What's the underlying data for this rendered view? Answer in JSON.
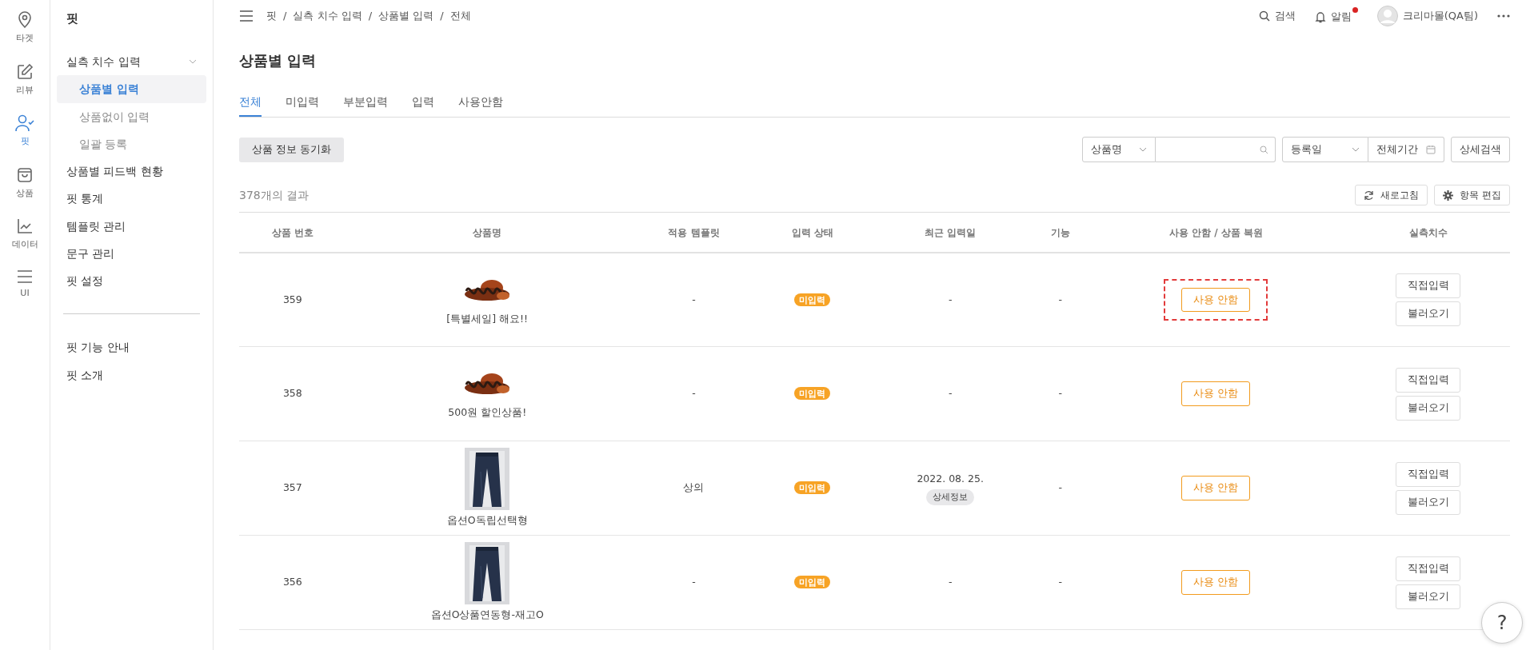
{
  "rail": [
    {
      "label": "타겟",
      "selected": false
    },
    {
      "label": "리뷰",
      "selected": false
    },
    {
      "label": "핏",
      "selected": true
    },
    {
      "label": "상품",
      "selected": false
    },
    {
      "label": "데이터",
      "selected": false
    },
    {
      "label": "UI",
      "selected": false
    }
  ],
  "sidebar": {
    "title": "핏",
    "items": [
      {
        "label": "실측 치수 입력",
        "expanded": true,
        "selected": false,
        "children": [
          {
            "label": "상품별 입력",
            "selected": true
          },
          {
            "label": "상품없이 입력",
            "selected": false
          },
          {
            "label": "일괄 등록",
            "selected": false
          }
        ]
      },
      {
        "label": "상품별 피드백 현황",
        "selected": false
      },
      {
        "label": "핏 통계",
        "selected": false
      },
      {
        "label": "템플릿 관리",
        "selected": false
      },
      {
        "label": "문구 관리",
        "selected": false
      },
      {
        "label": "핏 설정",
        "selected": false
      }
    ],
    "help_items": [
      {
        "label": "핏 기능 안내"
      },
      {
        "label": "핏 소개"
      }
    ]
  },
  "breadcrumb": {
    "separator": "/",
    "items": [
      "핏",
      "실측 치수 입력",
      "상품별 입력",
      "전체"
    ]
  },
  "header": {
    "search": "검색",
    "alerts": {
      "label": "알림",
      "unread": true
    },
    "user": "크리마몰(QA팀)"
  },
  "page_title": "상품별 입력",
  "tabs": [
    {
      "label": "전체",
      "selected": true
    },
    {
      "label": "미입력",
      "selected": false
    },
    {
      "label": "부분입력",
      "selected": false
    },
    {
      "label": "입력",
      "selected": false
    },
    {
      "label": "사용안함",
      "selected": false
    }
  ],
  "sync_button": "상품 정보 동기화",
  "filters": {
    "search_type": "상품명",
    "date_type": "등록일",
    "period": "전체기간",
    "detail_search": "상세검색"
  },
  "result_count": "378개의 결과",
  "refresh_button": "새로고침",
  "edit_columns_button": "항목 편집",
  "table": {
    "columns": [
      "상품 번호",
      "상품명",
      "적용 템플릿",
      "입력 상태",
      "최근 입력일",
      "기능",
      "사용 안함 / 상품 복원",
      "실측치수"
    ],
    "rows": [
      {
        "number": "359",
        "image": {
          "kind": "picture"
        },
        "name": "[특별세일] 해요!!",
        "template": "-",
        "status": "미입력",
        "last_input": "-",
        "function": "-",
        "disable_button": "사용 안함",
        "highlighted": true,
        "actions": [
          "직접입력",
          "불러오기"
        ]
      },
      {
        "number": "358",
        "image": {
          "kind": "picture"
        },
        "name": "500원 할인상품!",
        "template": "-",
        "status": "미입력",
        "last_input": "-",
        "function": "-",
        "disable_button": "사용 안함",
        "highlighted": false,
        "actions": [
          "직접입력",
          "불러오기"
        ]
      },
      {
        "number": "357",
        "image": {
          "kind": "picture"
        },
        "name": "옵션O독립선택형",
        "template": "상의",
        "status": "미입력",
        "last_input": "2022. 08. 25.",
        "detail_badge": "상세정보",
        "function": "-",
        "disable_button": "사용 안함",
        "highlighted": false,
        "actions": [
          "직접입력",
          "불러오기"
        ]
      },
      {
        "number": "356",
        "image": {
          "kind": "picture"
        },
        "name": "옵션O상품연동형-재고O",
        "template": "-",
        "status": "미입력",
        "last_input": "-",
        "function": "-",
        "disable_button": "사용 안함",
        "highlighted": false,
        "actions": [
          "직접입력",
          "불러오기"
        ]
      }
    ]
  },
  "help_button": "?"
}
